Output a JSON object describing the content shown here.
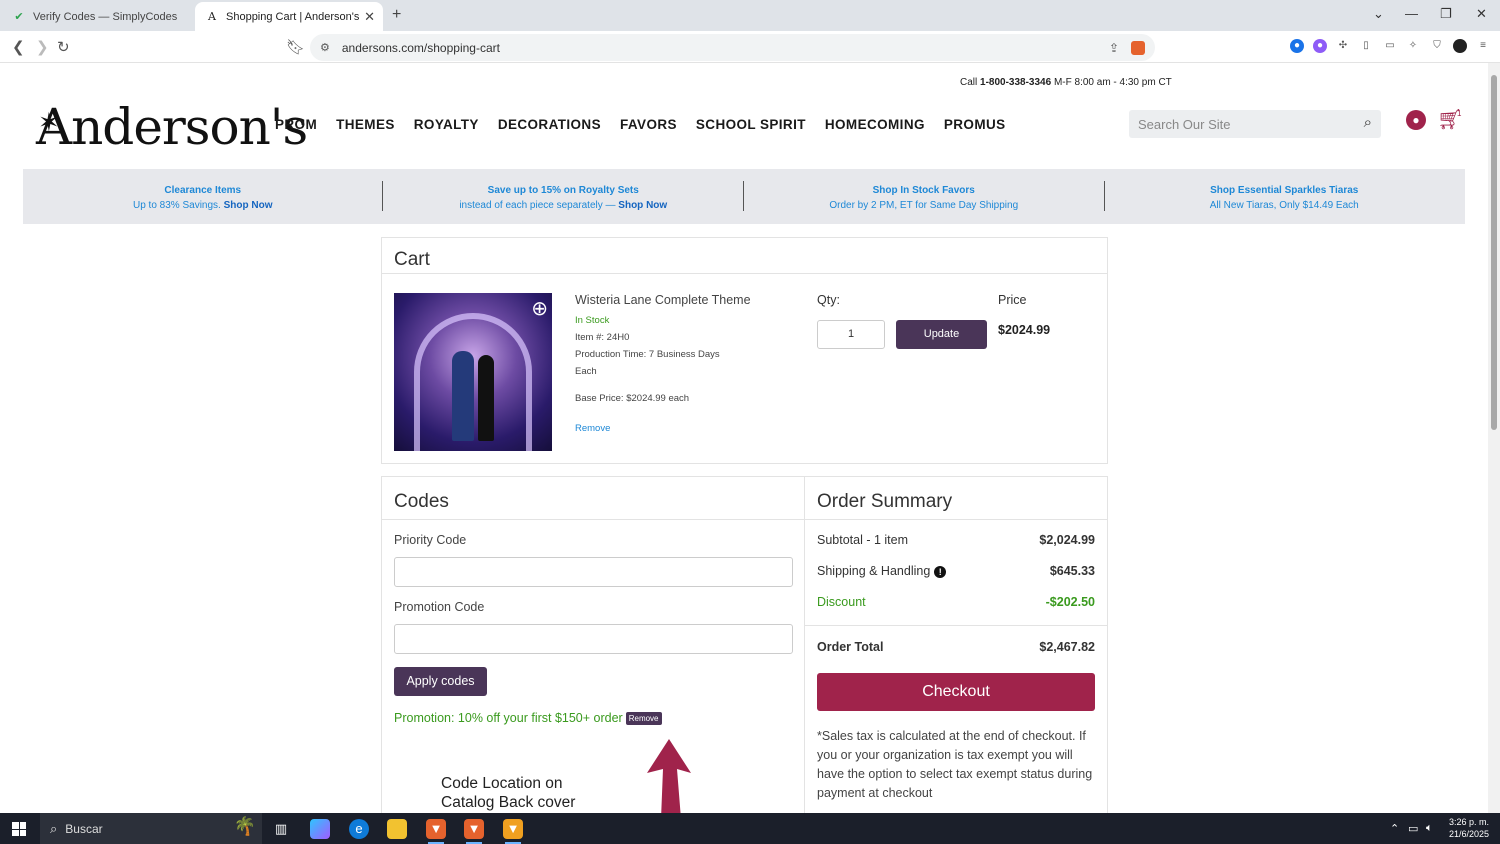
{
  "browser": {
    "tabs": [
      {
        "title": "Verify Codes — SimplyCodes",
        "active": false
      },
      {
        "title": "Shopping Cart | Anderson's",
        "active": true
      }
    ],
    "url": "andersons.com/shopping-cart"
  },
  "header": {
    "call_prefix": "Call ",
    "phone": "1-800-338-3346",
    "hours": " M-F 8:00 am - 4:30 pm CT",
    "logo": "Anderson's",
    "nav": [
      "PROM",
      "THEMES",
      "ROYALTY",
      "DECORATIONS",
      "FAVORS",
      "SCHOOL SPIRIT",
      "HOMECOMING",
      "PROMUS"
    ],
    "search_placeholder": "Search Our Site",
    "cart_count": "1"
  },
  "promos": [
    {
      "title": "Clearance Items",
      "sub": "Up to 83% Savings. ",
      "cta": "Shop Now"
    },
    {
      "title": "Save up to 15% on Royalty Sets",
      "sub": "instead of each piece separately — ",
      "cta": "Shop Now"
    },
    {
      "title": "Shop In Stock Favors",
      "sub": "Order by 2 PM, ET for Same Day Shipping",
      "cta": ""
    },
    {
      "title": "Shop Essential Sparkles Tiaras",
      "sub": "All New Tiaras, Only $14.49 Each",
      "cta": ""
    }
  ],
  "cart": {
    "heading": "Cart",
    "item": {
      "name": "Wisteria Lane Complete Theme",
      "stock": "In Stock",
      "item_no": "Item #: 24H0",
      "production": "Production Time: 7 Business Days",
      "unit": "Each",
      "base_price": "Base Price: $2024.99 each",
      "remove": "Remove",
      "qty_label": "Qty:",
      "qty": "1",
      "update": "Update",
      "price_label": "Price",
      "price": "$2024.99"
    }
  },
  "codes": {
    "heading": "Codes",
    "priority_label": "Priority Code",
    "promotion_label": "Promotion Code",
    "apply": "Apply codes",
    "applied_msg": "Promotion: 10% off your first $150+ order",
    "applied_remove": "Remove",
    "annotation_line1": "Code Location on",
    "annotation_line2": "Catalog Back cover"
  },
  "summary": {
    "heading": "Order Summary",
    "subtotal_label": "Subtotal - 1 item",
    "subtotal": "$2,024.99",
    "shipping_label": "Shipping & Handling",
    "shipping": "$645.33",
    "discount_label": "Discount",
    "discount": "-$202.50",
    "total_label": "Order Total",
    "total": "$2,467.82",
    "checkout": "Checkout",
    "tax_note": "*Sales tax is calculated at the end of checkout. If you or your organization is tax exempt you will have the option to select tax exempt status during payment at checkout"
  },
  "taskbar": {
    "search": "Buscar",
    "time": "3:26 p. m.",
    "date": "21/6/2025"
  },
  "colors": {
    "brand": "#a0234b",
    "button": "#4a3558",
    "link": "#1e88d6",
    "success": "#3a9a1e"
  }
}
